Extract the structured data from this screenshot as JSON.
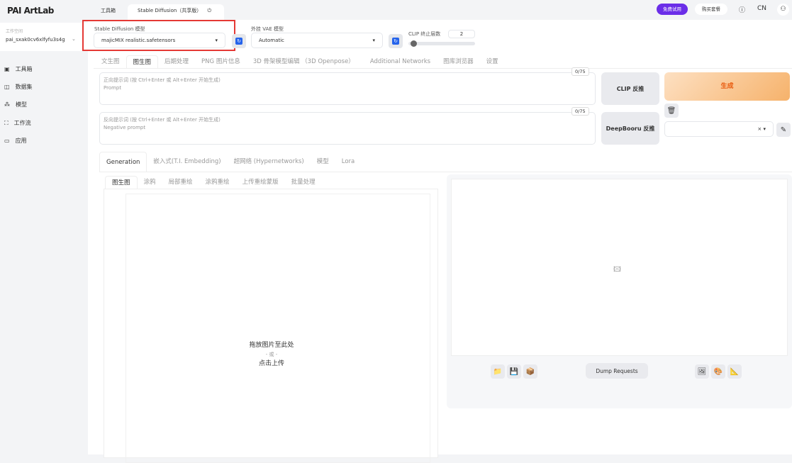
{
  "app": {
    "logo": "PAI ArtLab"
  },
  "topbar": {
    "tabs": [
      "工具箱",
      "Stable Diffusion（共享版）"
    ],
    "trial": "免费试用",
    "buy": "购买套餐",
    "lang": "CN"
  },
  "sidebar": {
    "workspace_label": "工作空间",
    "workspace": "pai_sxak0cv6xlfyfu3s4g",
    "items": [
      "工具箱",
      "数据集",
      "模型",
      "工作流",
      "应用"
    ]
  },
  "settings": {
    "sd_model_label": "Stable Diffusion 模型",
    "sd_model": "majicMIX realistic.safetensors",
    "vae_label": "外挂 VAE 模型",
    "vae": "Automatic",
    "clip_label": "CLIP 终止层数",
    "clip_value": "2",
    "clip_fraction": 0.0
  },
  "main_tabs": [
    "文生图",
    "图生图",
    "后期处理",
    "PNG 图片信息",
    "3D 骨架模型编辑 （3D Openpose）",
    "Additional Networks",
    "图库浏览器",
    "设置"
  ],
  "prompt": {
    "placeholder": "正向提示词 (按 Ctrl+Enter 或 Alt+Enter 开始生成)",
    "sub": "Prompt",
    "count": "0/75"
  },
  "negative": {
    "placeholder": "反向提示词 (按 Ctrl+Enter 或 Alt+Enter 开始生成)",
    "sub": "Negative prompt",
    "count": "0/75"
  },
  "buttons": {
    "clip": "CLIP 反推",
    "deepbooru": "DeepBooru 反推",
    "generate": "生成",
    "dump": "Dump Requests"
  },
  "sub_tabs": [
    "Generation",
    "嵌入式(T.I. Embedding)",
    "超网络 (Hypernetworks)",
    "模型",
    "Lora"
  ],
  "img_tabs": [
    "图生图",
    "涂鸦",
    "局部重绘",
    "涂鸦重绘",
    "上传重绘蒙版",
    "批量处理"
  ],
  "upload": {
    "line1": "拖放图片至此处",
    "line2": "- 或 -",
    "line3": "点击上传"
  }
}
